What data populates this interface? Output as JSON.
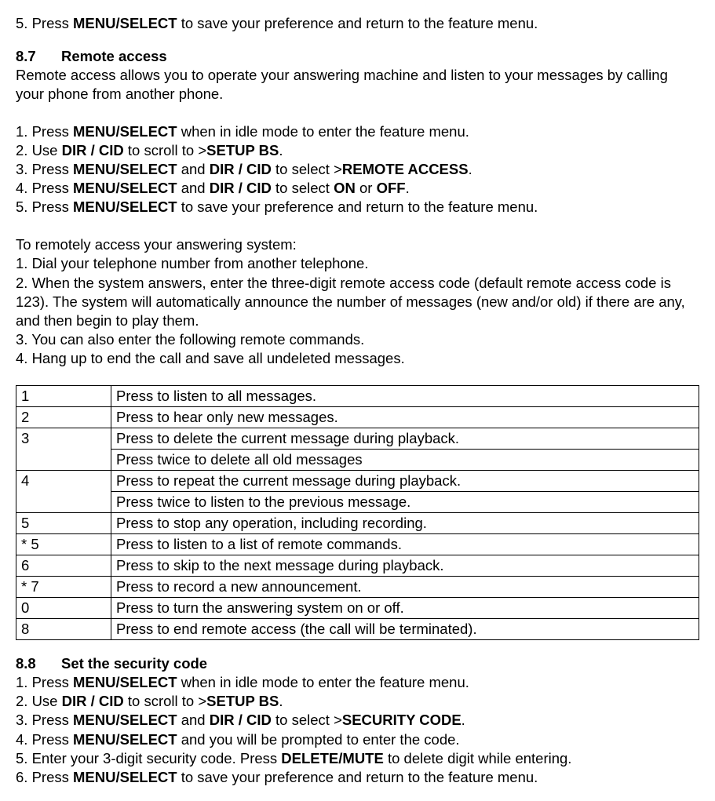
{
  "intro_step5": {
    "prefix": "5. Press ",
    "key": "MENU/SELECT",
    "suffix": " to save your preference and return to the feature menu."
  },
  "s87": {
    "num": "8.7",
    "title": "Remote access",
    "intro": "Remote access allows you to operate your answering machine and listen to your messages by calling your phone from another phone.",
    "steps": [
      {
        "pre": "1. Press ",
        "b1": "MENU/SELECT",
        "mid": " when in idle mode to enter the feature menu.",
        "b2": "",
        "post": ""
      },
      {
        "pre": "2. Use ",
        "b1": "DIR / CID",
        "mid": " to scroll to >",
        "b2": "SETUP BS",
        "post": "."
      },
      {
        "pre": "3. Press ",
        "b1": "MENU/SELECT",
        "mid": " and ",
        "b2": "DIR / CID",
        "post": " to select >",
        "b3": "REMOTE ACCESS",
        "post2": "."
      },
      {
        "pre": "4. Press ",
        "b1": "MENU/SELECT",
        "mid": " and ",
        "b2": "DIR / CID",
        "post": " to select ",
        "b3": "ON",
        "post2": " or ",
        "b4": "OFF",
        "post3": "."
      },
      {
        "pre": "5. Press ",
        "b1": "MENU/SELECT",
        "mid": " to save your preference and return to the feature menu.",
        "b2": "",
        "post": ""
      }
    ],
    "remote_heading": "To remotely access your answering system:",
    "remote_steps": [
      "1. Dial your telephone number from another telephone.",
      "2. When the system answers, enter the three-digit remote access code (default remote access code is 123). The system will automatically announce the number of messages (new and/or old) if there are any, and then begin to play them.",
      "3. You can also enter the following remote commands.",
      "4. Hang up to end the call and save all undeleted messages."
    ]
  },
  "table": {
    "rows": [
      {
        "key": "1",
        "desc": "Press to listen to all messages."
      },
      {
        "key": "2",
        "desc": "Press to hear only new messages."
      },
      {
        "key": "3",
        "desc": "Press to delete the current message during playback.",
        "desc2": "Press twice to delete all old messages"
      },
      {
        "key": "4",
        "desc": "Press to repeat the current message during playback.",
        "desc2": "Press twice to listen to the previous message."
      },
      {
        "key": "5",
        "desc": "Press to stop any operation, including recording."
      },
      {
        "key": "* 5",
        "desc": "Press to listen to a list of remote commands."
      },
      {
        "key": "6",
        "desc": "Press to skip to the next message during playback."
      },
      {
        "key": "* 7",
        "desc": "Press to record a new announcement."
      },
      {
        "key": "0",
        "desc": "Press to turn the answering system on or off."
      },
      {
        "key": "8",
        "desc": "Press to end remote access (the call will be terminated)."
      }
    ]
  },
  "s88": {
    "num": "8.8",
    "title": "Set the security code",
    "steps": [
      {
        "pre": "1. Press ",
        "b1": "MENU/SELECT",
        "mid": " when in idle mode to enter the feature menu."
      },
      {
        "pre": "2. Use ",
        "b1": "DIR / CID",
        "mid": " to scroll to >",
        "b2": "SETUP BS",
        "post": "."
      },
      {
        "pre": "3. Press ",
        "b1": "MENU/SELECT",
        "mid": " and ",
        "b2": "DIR / CID",
        "post": " to select >",
        "b3": "SECURITY CODE",
        "post2": "."
      },
      {
        "pre": "4. Press ",
        "b1": "MENU/SELECT",
        "mid": " and you will be prompted to enter the code."
      },
      {
        "pre": "5. Enter your 3-digit security code. Press ",
        "b1": "DELETE/MUTE",
        "mid": " to delete digit while entering."
      },
      {
        "pre": "6. Press ",
        "b1": "MENU/SELECT",
        "mid": " to save your preference and return to the feature menu."
      }
    ]
  }
}
